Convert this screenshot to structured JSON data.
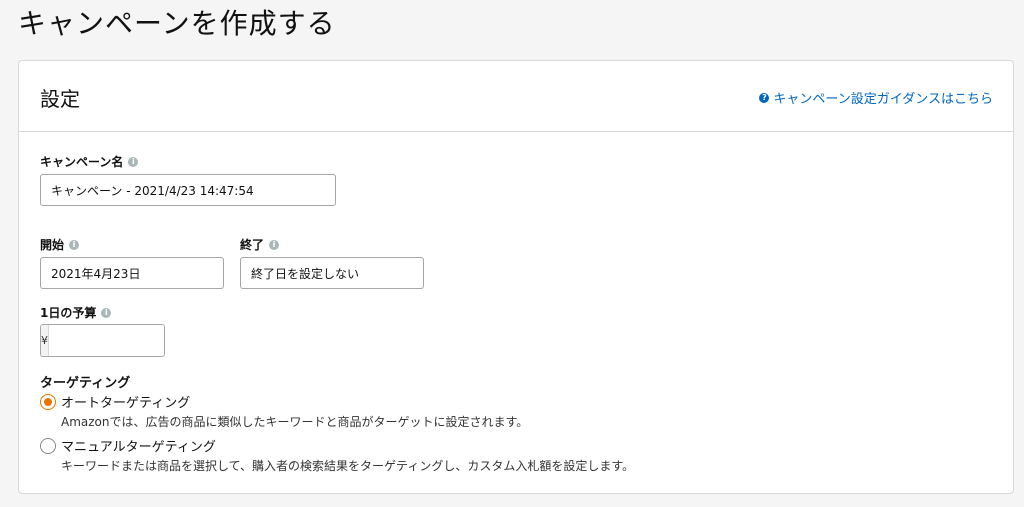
{
  "page": {
    "title": "キャンペーンを作成する"
  },
  "settings": {
    "title": "設定",
    "guide_link": "キャンペーン設定ガイダンスはこちら"
  },
  "campaign_name": {
    "label": "キャンペーン名",
    "value": "キャンペーン - 2021/4/23 14:47:54"
  },
  "start": {
    "label": "開始",
    "value": "2021年4月23日"
  },
  "end": {
    "label": "終了",
    "value": "終了日を設定しない"
  },
  "budget": {
    "label": "1日の予算",
    "currency": "¥",
    "value": ""
  },
  "targeting": {
    "label": "ターゲティング",
    "options": [
      {
        "label": "オートターゲティング",
        "description": "Amazonでは、広告の商品に類似したキーワードと商品がターゲットに設定されます。",
        "selected": true
      },
      {
        "label": "マニュアルターゲティング",
        "description": "キーワードまたは商品を選択して、購入者の検索結果をターゲティングし、カスタム入札額を設定します。",
        "selected": false
      }
    ]
  },
  "colors": {
    "link": "#0066c0",
    "radio_selected": "#e77600",
    "border": "#d5d9d9"
  }
}
